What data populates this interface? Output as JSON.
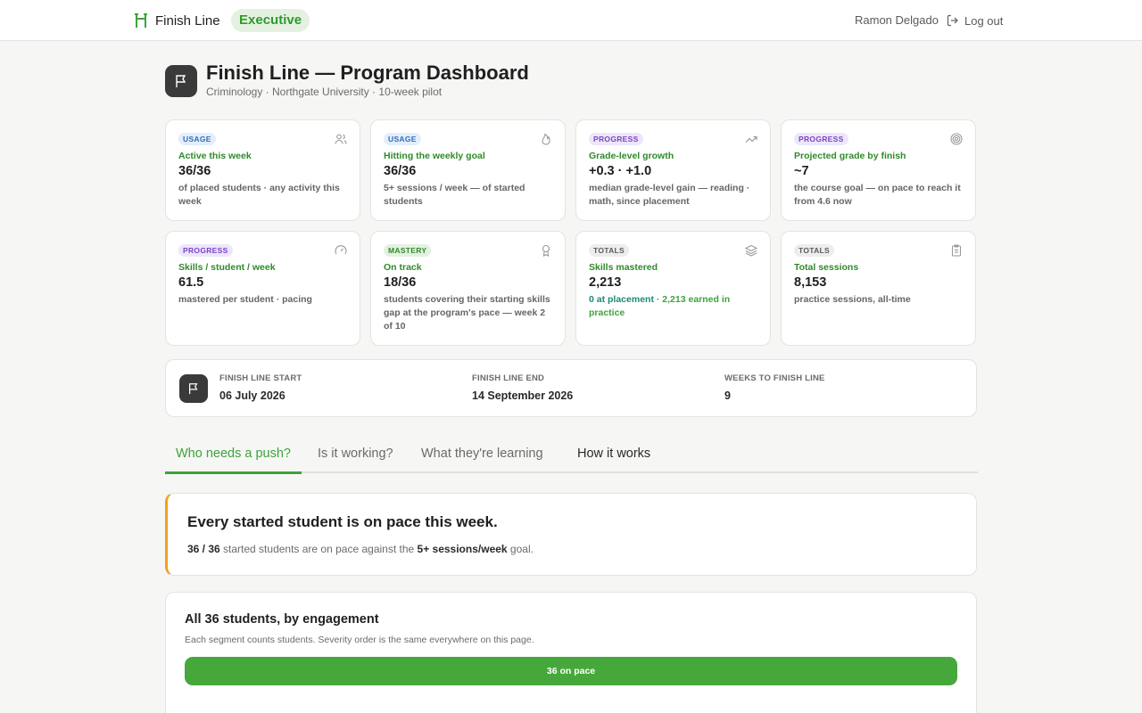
{
  "nav": {
    "brand": "Finish Line",
    "role": "Executive",
    "user": "Ramon Delgado",
    "logout": "Log out"
  },
  "header": {
    "title": "Finish Line — Program Dashboard",
    "subtitle": "Criminology · Northgate University · 10-week pilot"
  },
  "cards": [
    {
      "tag": "USAGE",
      "icon": "users-icon",
      "label": "Active this week",
      "value": "36/36",
      "desc": "of placed students · any activity this week"
    },
    {
      "tag": "USAGE",
      "icon": "flame-icon",
      "label": "Hitting the weekly goal",
      "value": "36/36",
      "desc": "5+ sessions / week — of started students"
    },
    {
      "tag": "PROGRESS",
      "icon": "trend-up-icon",
      "label": "Grade-level growth",
      "value": "+0.3 · +1.0",
      "desc": "median grade-level gain — reading · math, since placement"
    },
    {
      "tag": "PROGRESS",
      "icon": "target-icon",
      "label": "Projected grade by finish",
      "value": "~7",
      "desc": "the course goal — on pace to reach it from 4.6 now"
    },
    {
      "tag": "PROGRESS",
      "icon": "gauge-icon",
      "label": "Skills / student / week",
      "value": "61.5",
      "desc": "mastered per student · pacing"
    },
    {
      "tag": "MASTERY",
      "icon": "award-icon",
      "label": "On track",
      "value": "18/36",
      "desc": "students covering their starting skills gap at the program's pace — week 2 of 10"
    },
    {
      "tag": "TOTALS",
      "icon": "layers-icon",
      "label": "Skills mastered",
      "value": "2,213",
      "desc_a": "0 at placement",
      "desc_sep": " · ",
      "desc_b": "2,213 earned in practice"
    },
    {
      "tag": "TOTALS",
      "icon": "clipboard-icon",
      "label": "Total sessions",
      "value": "8,153",
      "desc": "practice sessions, all-time"
    }
  ],
  "dates": {
    "start_label": "FINISH LINE START",
    "start_value": "06 July 2026",
    "end_label": "FINISH LINE END",
    "end_value": "14 September 2026",
    "weeks_label": "WEEKS TO FINISH LINE",
    "weeks_value": "9"
  },
  "tabs": [
    {
      "label": "Who needs a push?",
      "active": true
    },
    {
      "label": "Is it working?"
    },
    {
      "label": "What they're learning"
    },
    {
      "label": "How it works"
    }
  ],
  "callout": {
    "title": "Every started student is on pace this week.",
    "count": "36 / 36",
    "text_mid": " started students are on pace against the ",
    "goal": "5+ sessions/week",
    "text_end": " goal."
  },
  "engagement": {
    "title": "All 36 students, by engagement",
    "subtitle": "Each segment counts students. Severity order is the same everywhere on this page.",
    "segments": [
      {
        "label": "36 on pace",
        "count": 36,
        "color": "#46a83b"
      }
    ]
  },
  "colors": {
    "accent": "#3ea33a",
    "warning": "#f0a020",
    "dark": "#3a3a3a"
  }
}
